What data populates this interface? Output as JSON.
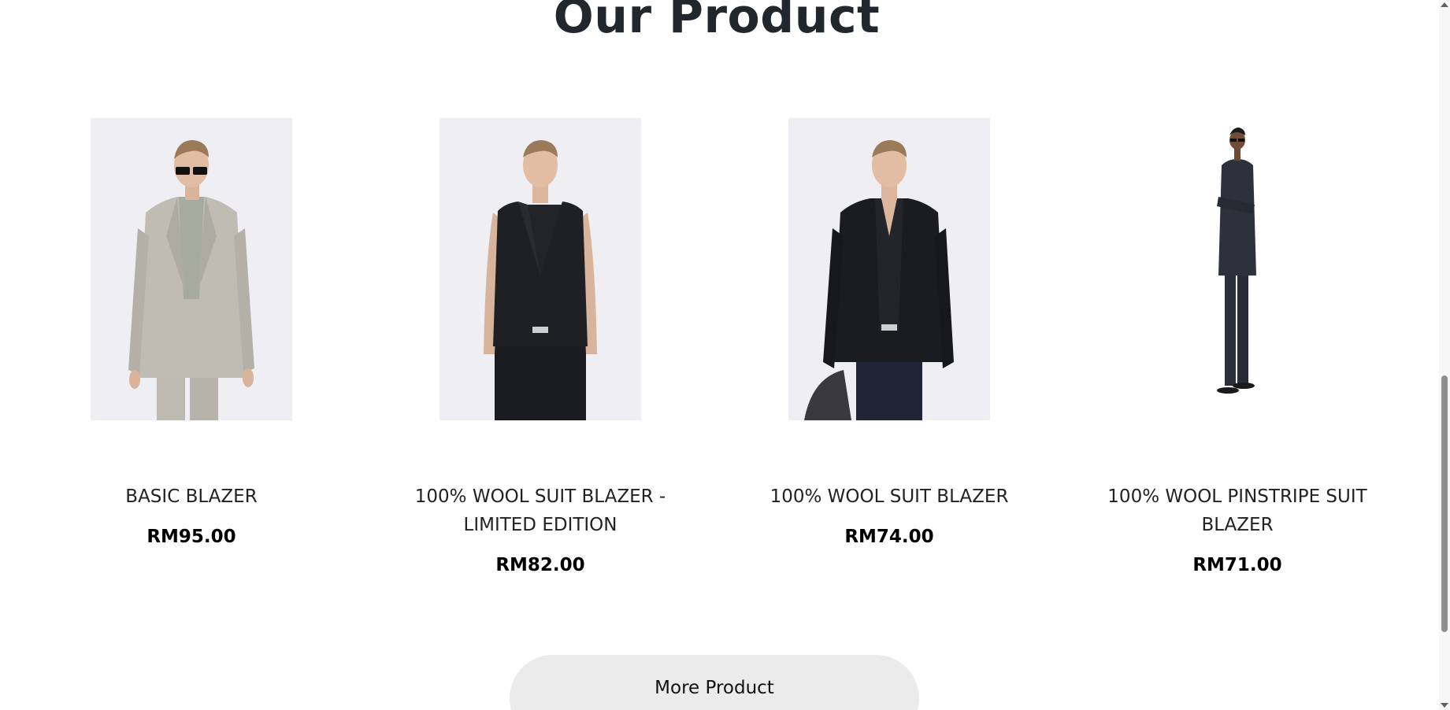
{
  "section": {
    "title": "Our Product"
  },
  "products": [
    {
      "name": "BASIC BLAZER",
      "price": "RM95.00",
      "image": "man-beige-blazer-sunglasses"
    },
    {
      "name": "100% WOOL SUIT BLAZER - LIMITED EDITION",
      "price": "RM82.00",
      "image": "man-black-vest"
    },
    {
      "name": "100% WOOL SUIT BLAZER",
      "price": "RM74.00",
      "image": "man-black-blazer-jeans"
    },
    {
      "name": "100% WOOL PINSTRIPE SUIT BLAZER",
      "price": "RM71.00",
      "image": "man-navy-suit-full-length"
    }
  ],
  "more_button": {
    "label": "More Product"
  },
  "colors": {
    "title": "#22272e",
    "button_bg": "#ebebeb",
    "photo_bg": "#efeff3"
  }
}
